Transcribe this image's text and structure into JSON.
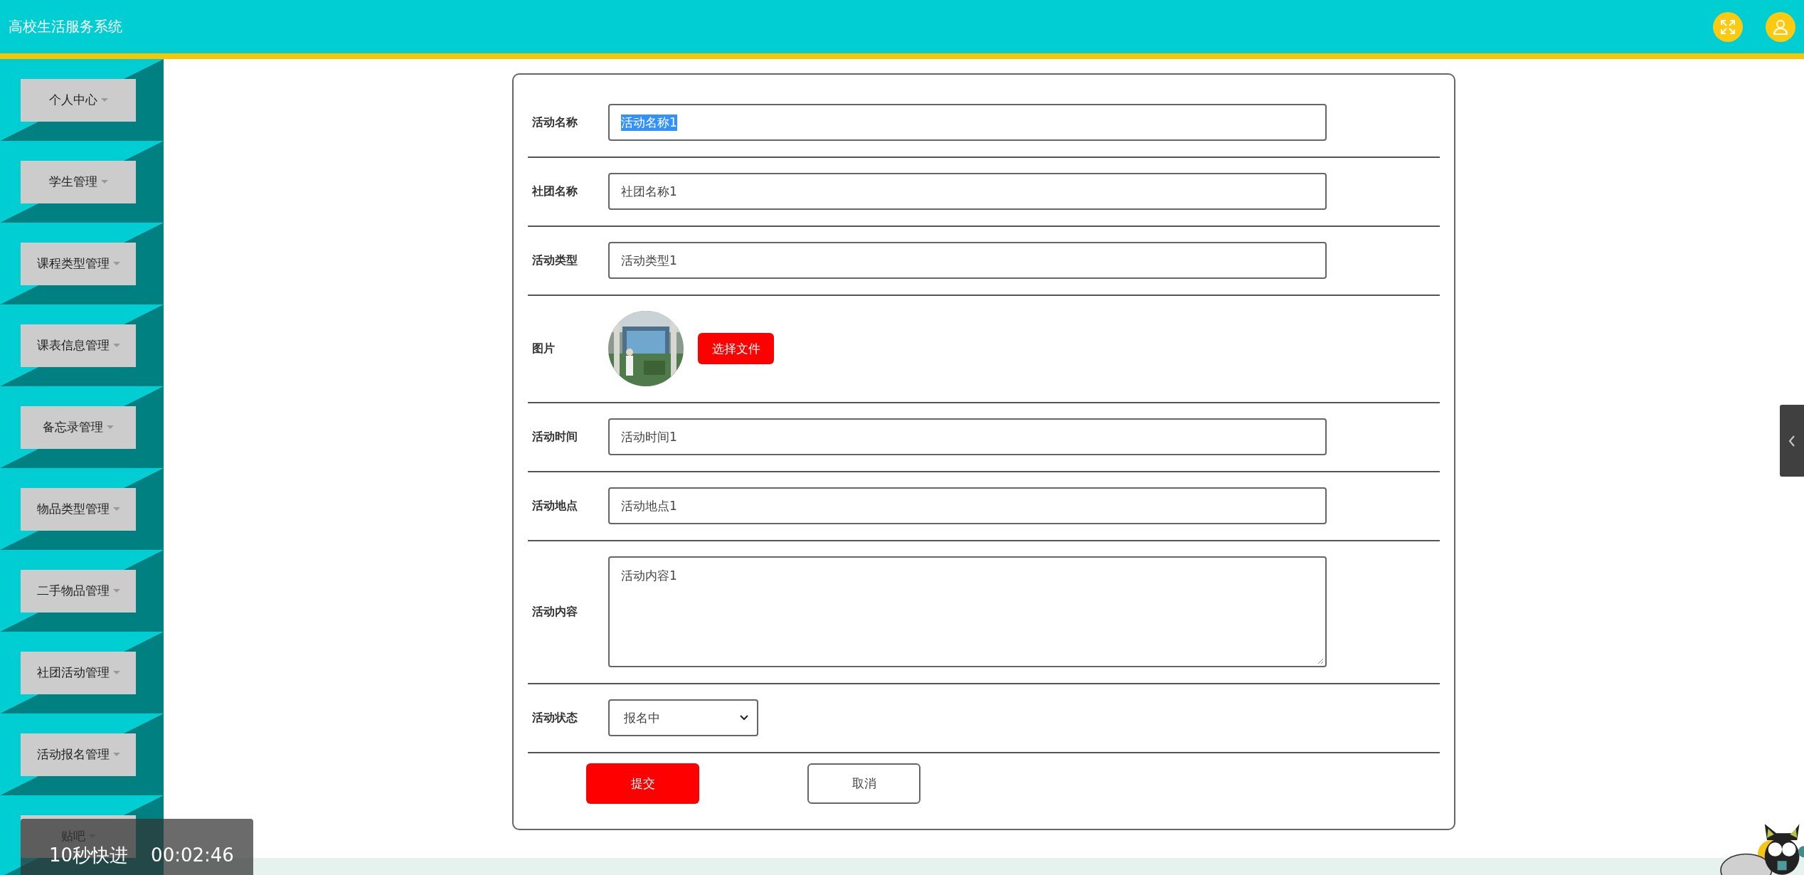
{
  "header": {
    "title": "高校生活服务系统"
  },
  "sidebar": {
    "items": [
      {
        "label": "个人中心"
      },
      {
        "label": "学生管理"
      },
      {
        "label": "课程类型管理"
      },
      {
        "label": "课表信息管理"
      },
      {
        "label": "备忘录管理"
      },
      {
        "label": "物品类型管理"
      },
      {
        "label": "二手物品管理"
      },
      {
        "label": "社团活动管理"
      },
      {
        "label": "活动报名管理"
      },
      {
        "label": "贴吧"
      }
    ]
  },
  "form": {
    "fields": [
      {
        "label": "活动名称",
        "kind": "text",
        "value": "活动名称1",
        "highlighted": true
      },
      {
        "label": "社团名称",
        "kind": "text",
        "value": "社团名称1",
        "highlighted": false
      },
      {
        "label": "活动类型",
        "kind": "text",
        "value": "活动类型1",
        "highlighted": false
      },
      {
        "label": "图片",
        "button": "选择文件"
      },
      {
        "label": "活动时间",
        "kind": "text",
        "value": "活动时间1",
        "highlighted": false
      },
      {
        "label": "活动地点",
        "kind": "text",
        "value": "活动地点1",
        "highlighted": false
      },
      {
        "label": "活动内容",
        "kind": "textarea",
        "value": "活动内容1"
      },
      {
        "label": "活动状态",
        "kind": "select",
        "value": "报名中"
      }
    ],
    "buttons": [
      {
        "label": "提交",
        "kind": "primary"
      },
      {
        "label": "取消",
        "kind": "secondary"
      }
    ]
  },
  "video_overlay": {
    "label": "10秒快进",
    "time": "00:02:46"
  }
}
